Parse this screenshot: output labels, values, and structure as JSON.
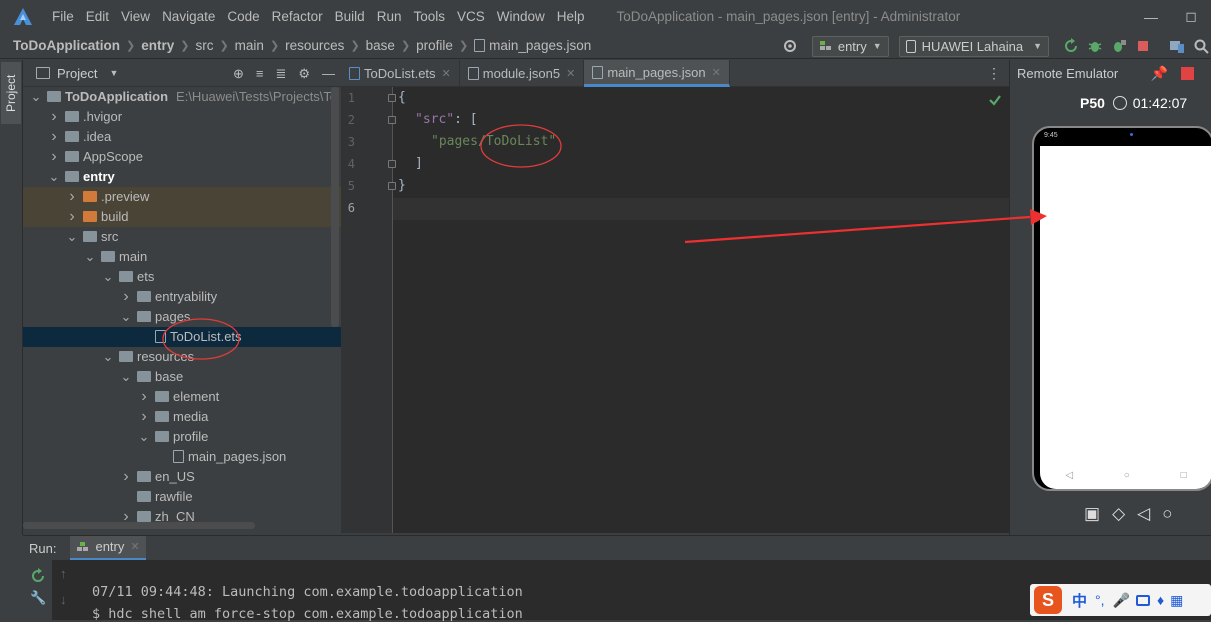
{
  "menubar": {
    "items": [
      "File",
      "Edit",
      "View",
      "Navigate",
      "Code",
      "Refactor",
      "Build",
      "Run",
      "Tools",
      "VCS",
      "Window",
      "Help"
    ],
    "title": "ToDoApplication - main_pages.json [entry] - Administrator"
  },
  "breadcrumb": [
    "ToDoApplication",
    "entry",
    "src",
    "main",
    "resources",
    "base",
    "profile",
    "main_pages.json"
  ],
  "toolbar": {
    "module_combo": "entry",
    "device_combo": "HUAWEI Lahaina"
  },
  "project_panel": {
    "side_tab": "Project",
    "title": "Project",
    "tree": [
      {
        "label": "ToDoApplication",
        "extra": "E:\\Huawei\\Tests\\Projects\\To",
        "depth": 0,
        "chev": "down",
        "icon": "folder",
        "bold": true
      },
      {
        "label": ".hvigor",
        "depth": 1,
        "chev": "right",
        "icon": "folder"
      },
      {
        "label": ".idea",
        "depth": 1,
        "chev": "right",
        "icon": "folder"
      },
      {
        "label": "AppScope",
        "depth": 1,
        "chev": "right",
        "icon": "folder"
      },
      {
        "label": "entry",
        "depth": 1,
        "chev": "down",
        "icon": "folder",
        "bold": true
      },
      {
        "label": ".preview",
        "depth": 2,
        "chev": "right",
        "icon": "folder-orange",
        "hl": "brown"
      },
      {
        "label": "build",
        "depth": 2,
        "chev": "right",
        "icon": "folder-orange",
        "hl": "brown"
      },
      {
        "label": "src",
        "depth": 2,
        "chev": "down",
        "icon": "folder"
      },
      {
        "label": "main",
        "depth": 3,
        "chev": "down",
        "icon": "folder"
      },
      {
        "label": "ets",
        "depth": 4,
        "chev": "down",
        "icon": "folder"
      },
      {
        "label": "entryability",
        "depth": 5,
        "chev": "right",
        "icon": "folder"
      },
      {
        "label": "pages",
        "depth": 5,
        "chev": "down",
        "icon": "folder"
      },
      {
        "label": "ToDoList.ets",
        "depth": 6,
        "chev": "none",
        "icon": "file",
        "selected": true
      },
      {
        "label": "resources",
        "depth": 4,
        "chev": "down",
        "icon": "folder"
      },
      {
        "label": "base",
        "depth": 5,
        "chev": "down",
        "icon": "folder"
      },
      {
        "label": "element",
        "depth": 6,
        "chev": "right",
        "icon": "folder"
      },
      {
        "label": "media",
        "depth": 6,
        "chev": "right",
        "icon": "folder"
      },
      {
        "label": "profile",
        "depth": 6,
        "chev": "down",
        "icon": "folder"
      },
      {
        "label": "main_pages.json",
        "depth": 7,
        "chev": "none",
        "icon": "file"
      },
      {
        "label": "en_US",
        "depth": 5,
        "chev": "right",
        "icon": "folder"
      },
      {
        "label": "rawfile",
        "depth": 5,
        "chev": "none",
        "icon": "folder"
      },
      {
        "label": "zh_CN",
        "depth": 5,
        "chev": "right",
        "icon": "folder"
      }
    ]
  },
  "editor": {
    "tabs": [
      {
        "label": "ToDoList.ets",
        "active": false
      },
      {
        "label": "module.json5",
        "active": false
      },
      {
        "label": "main_pages.json",
        "active": true
      }
    ],
    "line_numbers": [
      "1",
      "2",
      "3",
      "4",
      "5",
      "6"
    ],
    "code": {
      "l1": "{",
      "l2_key": "\"src\"",
      "l2_rest": ": [",
      "l3": "\"pages/ToDoList\"",
      "l4": "]",
      "l5": "}"
    }
  },
  "emulator": {
    "title": "Remote Emulator",
    "device": "P50",
    "time": "01:42:07",
    "phone_status_time": "9:45"
  },
  "run": {
    "label": "Run:",
    "tab": "entry",
    "lines": [
      "07/11 09:44:48: Launching com.example.todoapplication",
      "$ hdc shell am force-stop com.example.todoapplication"
    ]
  },
  "ime": {
    "lang": "中"
  },
  "colors": {
    "accent": "#4a88c7",
    "annotation_red": "#e33b3b"
  }
}
